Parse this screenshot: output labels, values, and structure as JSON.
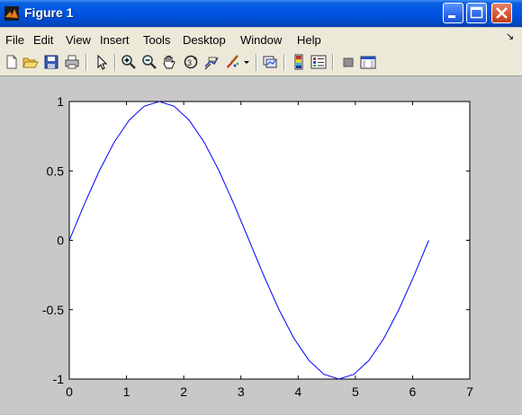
{
  "window": {
    "title": "Figure 1",
    "title_bar_color": "#0054e3",
    "close_button_color": "#d6542e"
  },
  "menu": {
    "items": [
      "File",
      "Edit",
      "View",
      "Insert",
      "Tools",
      "Desktop",
      "Window",
      "Help"
    ],
    "dock_glyph": "↘"
  },
  "toolbar": {
    "tools": [
      "new-figure-icon",
      "open-file-icon",
      "save-icon",
      "print-icon",
      "edit-plot-arrow-icon",
      "zoom-in-icon",
      "zoom-out-icon",
      "pan-hand-icon",
      "rotate-3d-icon",
      "data-cursor-icon",
      "brush-icon",
      "brush-dropdown-icon",
      "link-plot-icon",
      "colorbar-icon",
      "legend-icon",
      "hide-plot-tools-icon",
      "show-plot-tools-icon"
    ]
  },
  "chart_data": {
    "type": "line",
    "title": "",
    "xlabel": "",
    "ylabel": "",
    "xlim": [
      0,
      7
    ],
    "ylim": [
      -1,
      1
    ],
    "xticks": [
      "0",
      "1",
      "2",
      "3",
      "4",
      "5",
      "6",
      "7"
    ],
    "yticks": [
      "1",
      "0.5",
      "0",
      "-0.5",
      "-1"
    ],
    "ytick_values": [
      1,
      0.5,
      0,
      -0.5,
      -1
    ],
    "grid": false,
    "series": [
      {
        "color": "#0000ff",
        "x": [
          0,
          0.2618,
          0.5236,
          0.7854,
          1.0472,
          1.309,
          1.5708,
          1.8326,
          2.0944,
          2.3562,
          2.618,
          2.8798,
          3.1416,
          3.4034,
          3.6652,
          3.927,
          4.1888,
          4.4506,
          4.7124,
          4.9742,
          5.236,
          5.4978,
          5.7596,
          6.0214,
          6.2832
        ],
        "y": [
          0,
          0.2588,
          0.5,
          0.7071,
          0.866,
          0.9659,
          1,
          0.9659,
          0.866,
          0.7071,
          0.5,
          0.2588,
          0,
          -0.2588,
          -0.5,
          -0.7071,
          -0.866,
          -0.9659,
          -1,
          -0.9659,
          -0.866,
          -0.7071,
          -0.5,
          -0.2588,
          0
        ]
      }
    ]
  }
}
